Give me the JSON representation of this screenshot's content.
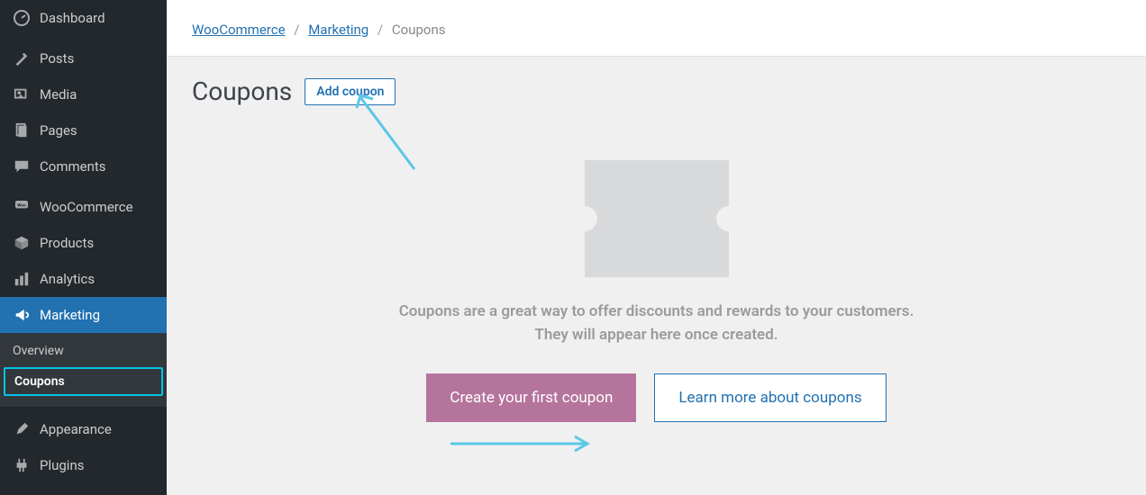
{
  "sidebar": {
    "items": [
      {
        "label": "Dashboard"
      },
      {
        "label": "Posts"
      },
      {
        "label": "Media"
      },
      {
        "label": "Pages"
      },
      {
        "label": "Comments"
      },
      {
        "label": "WooCommerce"
      },
      {
        "label": "Products"
      },
      {
        "label": "Analytics"
      },
      {
        "label": "Marketing"
      },
      {
        "label": "Appearance"
      },
      {
        "label": "Plugins"
      }
    ],
    "submenu": {
      "overview": "Overview",
      "coupons": "Coupons"
    }
  },
  "breadcrumb": {
    "woocommerce": "WooCommerce",
    "marketing": "Marketing",
    "coupons": "Coupons",
    "sep": "/"
  },
  "page": {
    "title": "Coupons",
    "add_btn": "Add coupon",
    "empty_text": "Coupons are a great way to offer discounts and rewards to your customers. They will appear here once created.",
    "create_btn": "Create your first coupon",
    "learn_btn": "Learn more about coupons"
  }
}
